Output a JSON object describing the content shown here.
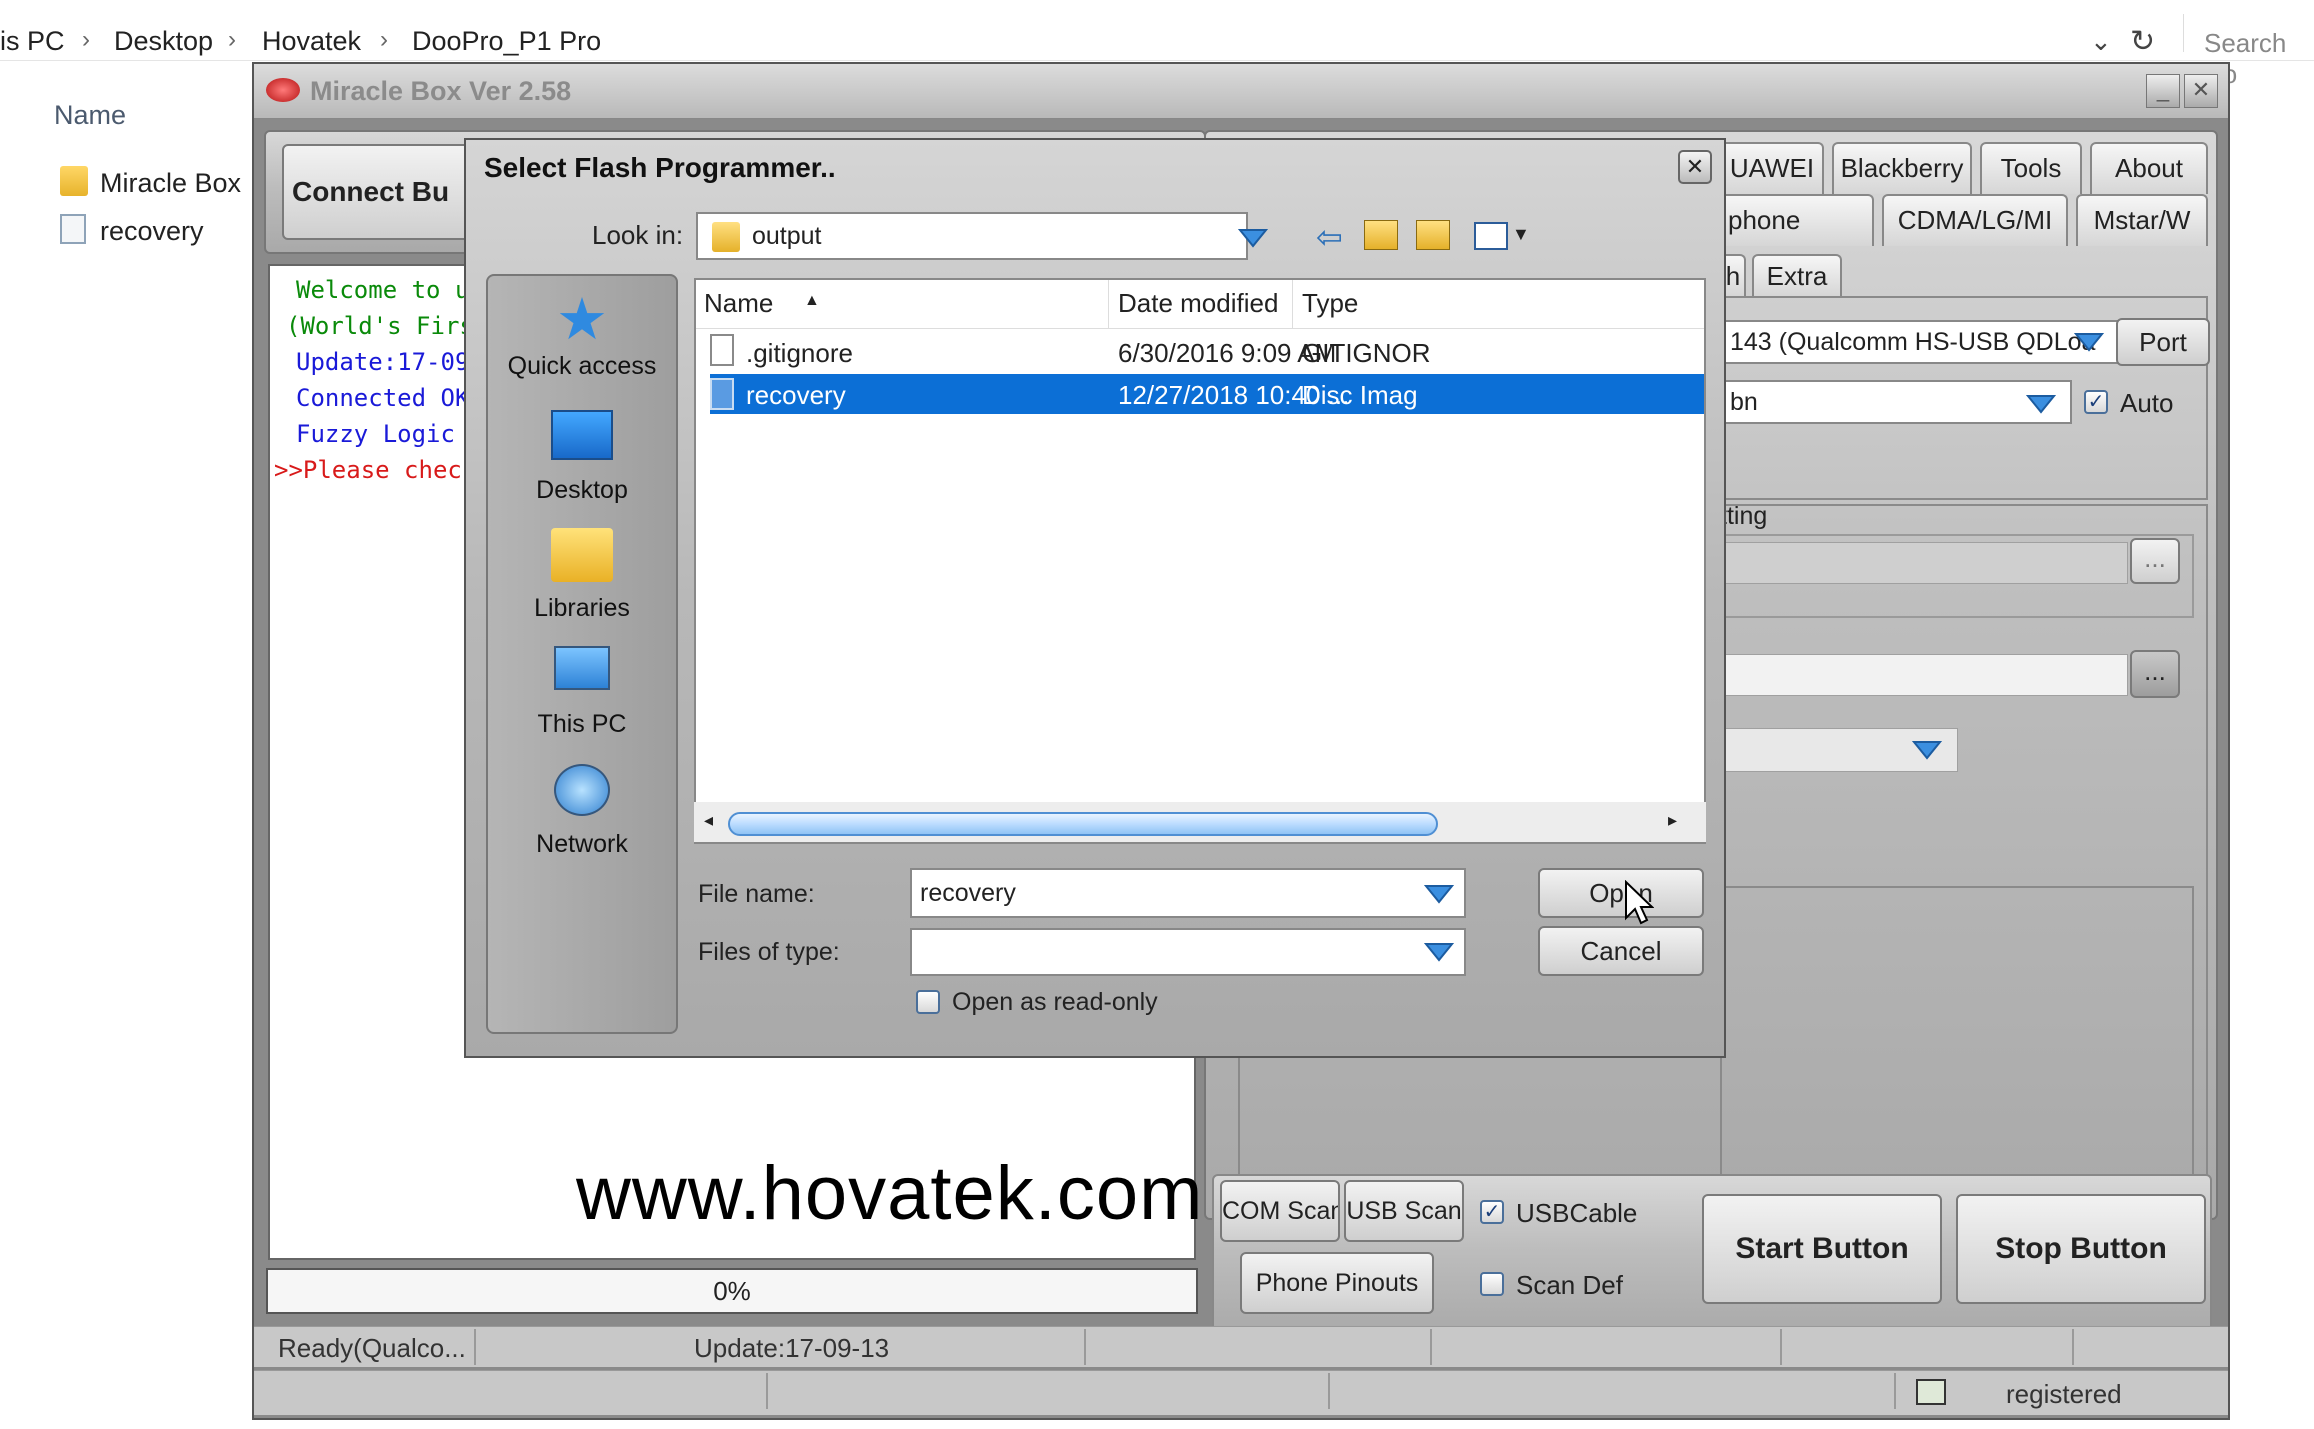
{
  "explorer": {
    "breadcrumb": [
      "is PC",
      "Desktop",
      "Hovatek",
      "DooPro_P1 Pro"
    ],
    "search_placeholder": "Search Do",
    "column_name": "Name",
    "items": [
      "Miracle Box",
      "recovery"
    ]
  },
  "miraclebox": {
    "title": "Miracle Box Ver 2.58",
    "connect_button": "Connect Bu",
    "tabs_row1": [
      "UAWEI",
      "Blackberry",
      "Tools",
      "About"
    ],
    "tabs_row2": [
      "phone",
      "CDMA/LG/MI",
      "Mstar/W"
    ],
    "tabs_row3": [
      "h",
      "Extra"
    ],
    "port_field": "143 (Qualcomm HS-USB QDLoa",
    "port_button": "Port",
    "mode_field": "bn",
    "auto_label": "Auto",
    "setting_label": "tting",
    "log_lines": [
      {
        "text": "Welcome to u",
        "color": "#0a8a0a"
      },
      {
        "text": "(World's Firs",
        "color": "#0a8a0a"
      },
      {
        "text": "Update:17-09-",
        "color": "#1a1ad8"
      },
      {
        "text": "Connected OK",
        "color": "#1a1ad8"
      },
      {
        "text": "Fuzzy Logic I",
        "color": "#1a1ad8"
      },
      {
        "text": ">>Please check",
        "color": "#d81a1a"
      }
    ],
    "progress": "0%",
    "com_scan": "COM Scan",
    "usb_scan": "USB Scan",
    "usbcable_label": "USBCable",
    "phone_pinouts": "Phone Pinouts",
    "scan_def_label": "Scan Def",
    "start_button": "Start Button",
    "stop_button": "Stop Button",
    "status_ready": "Ready(Qualco...",
    "status_update": "Update:17-09-13",
    "status_registered": "registered"
  },
  "dialog": {
    "title": "Select Flash Programmer..",
    "look_in_label": "Look in:",
    "look_in_value": "output",
    "places": [
      "Quick access",
      "Desktop",
      "Libraries",
      "This PC",
      "Network"
    ],
    "columns": [
      "Name",
      "Date modified",
      "Type"
    ],
    "files": [
      {
        "name": ".gitignore",
        "date": "6/30/2016 9:09 AM",
        "type": "GITIGNOR",
        "selected": false
      },
      {
        "name": "recovery",
        "date": "12/27/2018 10:40 ...",
        "type": "Disc Imag",
        "selected": true
      }
    ],
    "file_name_label": "File name:",
    "file_name_value": "recovery",
    "files_of_type_label": "Files of type:",
    "files_of_type_value": "",
    "read_only_label": "Open as read-only",
    "open_button": "Open",
    "cancel_button": "Cancel",
    "close_glyph": "✕"
  },
  "watermark": "www.hovatek.com",
  "colors": {
    "selection": "#0c6fd6",
    "log_green": "#0a8a0a",
    "log_blue": "#1a1ad8",
    "log_red": "#d81a1a"
  }
}
